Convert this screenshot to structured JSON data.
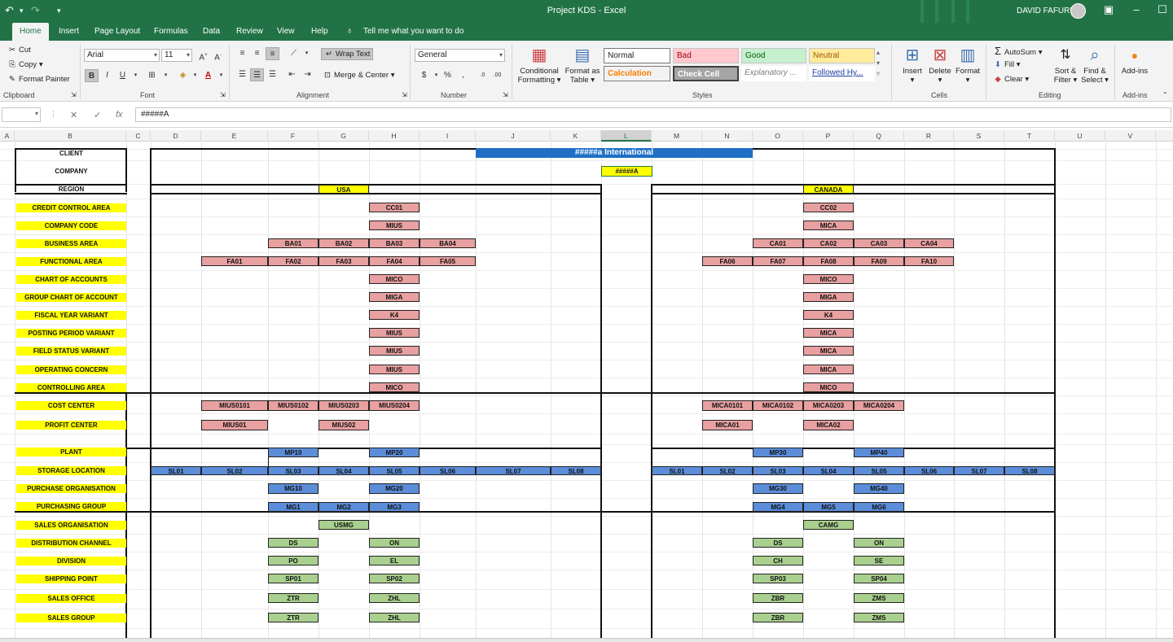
{
  "window": {
    "title": "Project KDS  -  Excel",
    "user": "DAVID FAFURE"
  },
  "tabs": [
    "Home",
    "Insert",
    "Page Layout",
    "Formulas",
    "Data",
    "Review",
    "View",
    "Help"
  ],
  "tell_me": "Tell me what you want to do",
  "ribbon": {
    "clipboard": {
      "cut": "Cut",
      "copy": "Copy",
      "format_painter": "Format Painter",
      "label": "Clipboard"
    },
    "font": {
      "name": "Arial",
      "size": "11",
      "label": "Font"
    },
    "alignment": {
      "wrap": "Wrap Text",
      "merge": "Merge & Center",
      "label": "Alignment"
    },
    "number": {
      "format": "General",
      "label": "Number"
    },
    "styles": {
      "conditional": [
        "Conditional",
        "Formatting"
      ],
      "format_as_table": [
        "Format as",
        "Table"
      ],
      "cells": [
        "Normal",
        "Bad",
        "Good",
        "Neutral",
        "Calculation",
        "Check Cell",
        "Explanatory ...",
        "Followed Hy..."
      ],
      "label": "Styles"
    },
    "cells": {
      "insert": "Insert",
      "delete": "Delete",
      "format": "Format",
      "label": "Cells"
    },
    "editing": {
      "autosum": "AutoSum",
      "fill": "Fill",
      "clear": "Clear",
      "sort": [
        "Sort &",
        "Filter"
      ],
      "find": [
        "Find &",
        "Select"
      ],
      "label": "Editing"
    },
    "addins": {
      "button": "Add-ins",
      "label": "Add-ins"
    }
  },
  "formula_bar": {
    "value": "#####A"
  },
  "columns": [
    "A",
    "B",
    "C",
    "D",
    "E",
    "F",
    "G",
    "H",
    "I",
    "J",
    "K",
    "L",
    "M",
    "N",
    "O",
    "P",
    "Q",
    "R",
    "S",
    "T",
    "U",
    "V"
  ],
  "selected_column": "L",
  "sheet": {
    "labels": {
      "client": "CLIENT",
      "company": "COMPANY",
      "region": "REGION",
      "rows": [
        "CREDIT CONTROL AREA",
        "COMPANY CODE",
        "BUSINESS AREA",
        "FUNCTIONAL AREA",
        "CHART OF ACCOUNTS",
        "GROUP CHART OF ACCOUNT",
        "FISCAL YEAR VARIANT",
        "POSTING PERIOD VARIANT",
        "FIELD STATUS VARIANT",
        "OPERATING CONCERN",
        "CONTROLLING AREA",
        "COST CENTER",
        "PROFIT CENTER",
        "PLANT",
        "STORAGE LOCATION",
        "PURCHASE ORGANISATION",
        "PURCHASING GROUP",
        "SALES ORGANISATION",
        "DISTRIBUTION CHANNEL",
        "DIVISION",
        "SHIPPING POINT",
        "SALES OFFICE",
        "SALES GROUP"
      ]
    },
    "client_banner": "#####a International",
    "company_code": "#####A",
    "regions": [
      "USA",
      "CANADA"
    ],
    "usa": {
      "ccarea": "CC01",
      "code": "MIUS",
      "business": [
        "BA01",
        "BA02",
        "BA03",
        "BA04"
      ],
      "functional": [
        "FA01",
        "FA02",
        "FA03",
        "FA04",
        "FA05"
      ],
      "coa": "MICO",
      "gcoa": "MIGA",
      "fyv": "K4",
      "ppv": "MIUS",
      "fsv": "MIUS",
      "opc": "MIUS",
      "ctrl": "MICO",
      "cost": [
        "MIUS0101",
        "MIUS0102",
        "MIUS0203",
        "MIUS0204"
      ],
      "profit": [
        "MIUS01",
        "MIUS02"
      ],
      "plant": [
        "MP10",
        "MP20"
      ],
      "storage": [
        "SL01",
        "SL02",
        "SL03",
        "SL04",
        "SL05",
        "SL06",
        "SL07",
        "SL08"
      ],
      "porg": [
        "MG10",
        "MG20"
      ],
      "pgrp": [
        "MG1",
        "MG2",
        "MG3"
      ],
      "sorg": "USMG",
      "dist": [
        "DS",
        "ON"
      ],
      "div": [
        "PO",
        "EL"
      ],
      "ship": [
        "SP01",
        "SP02"
      ],
      "soff": [
        "ZTR",
        "ZHL"
      ],
      "sgrp": [
        "ZTR",
        "ZHL"
      ]
    },
    "canada": {
      "ccarea": "CC02",
      "code": "MICA",
      "business": [
        "CA01",
        "CA02",
        "CA03",
        "CA04"
      ],
      "functional": [
        "FA06",
        "FA07",
        "FA08",
        "FA09",
        "FA10"
      ],
      "coa": "MICO",
      "gcoa": "MIGA",
      "fyv": "K4",
      "ppv": "MICA",
      "fsv": "MICA",
      "opc": "MICA",
      "ctrl": "MICO",
      "cost": [
        "MICA0101",
        "MICA0102",
        "MICA0203",
        "MICA0204"
      ],
      "profit": [
        "MICA01",
        "MICA02"
      ],
      "plant": [
        "MP30",
        "MP40"
      ],
      "storage": [
        "SL01",
        "SL02",
        "SL03",
        "SL04",
        "SL05",
        "SL06",
        "SL07",
        "SL08"
      ],
      "porg": [
        "MG30",
        "MG40"
      ],
      "pgrp": [
        "MG4",
        "MG5",
        "MG6"
      ],
      "sorg": "CAMG",
      "dist": [
        "DS",
        "ON"
      ],
      "div": [
        "CH",
        "SE"
      ],
      "ship": [
        "SP03",
        "SP04"
      ],
      "soff": [
        "ZBR",
        "ZMS"
      ],
      "sgrp": [
        "ZBR",
        "ZMS"
      ]
    }
  }
}
